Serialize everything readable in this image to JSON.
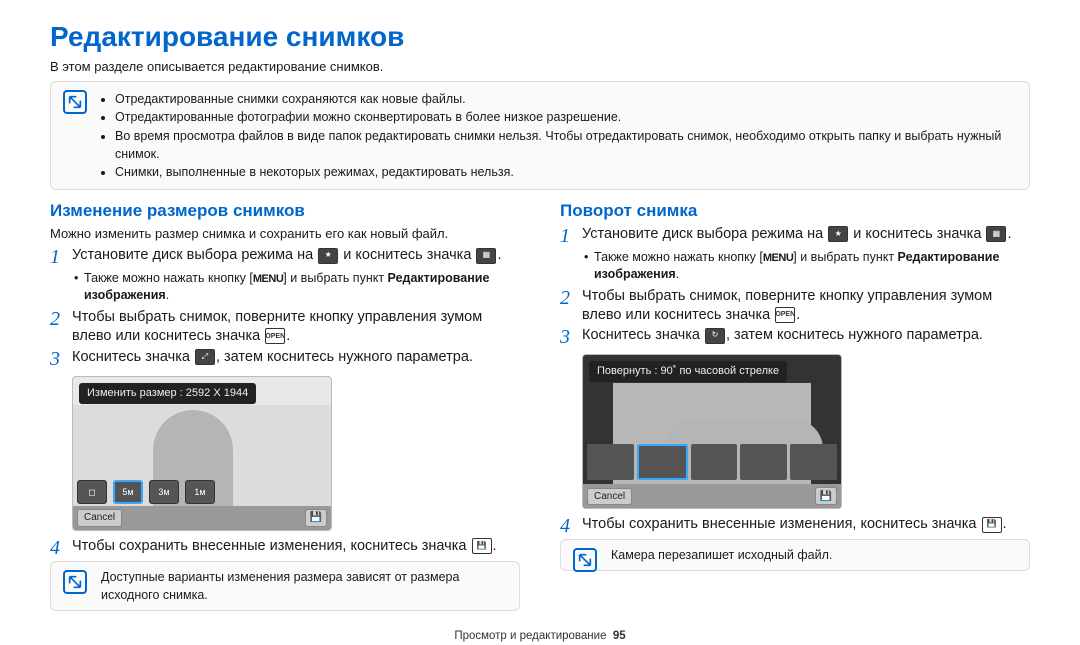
{
  "title": "Редактирование снимков",
  "intro": "В этом разделе описывается редактирование снимков.",
  "top_note": {
    "items": [
      "Отредактированные снимки сохраняются как новые файлы.",
      "Отредактированные фотографии можно сконвертировать в более низкое разрешение.",
      "Во время просмотра файлов в виде папок редактировать снимки нельзя. Чтобы отредактировать снимок, необходимо открыть папку и выбрать нужный снимок.",
      "Снимки, выполненные в некоторых режимах, редактировать нельзя."
    ]
  },
  "left": {
    "heading": "Изменение размеров снимков",
    "sub": "Можно изменить размер снимка и сохранить его как новый файл.",
    "step1a": "Установите диск выбора режима на ",
    "step1b": " и коснитесь значка ",
    "step1c": ".",
    "bullet1a": "Также можно нажать кнопку [",
    "bullet1_menu": "MENU",
    "bullet1b": "] и выбрать пункт ",
    "bullet1_bold": "Редактирование изображения",
    "bullet1c": ".",
    "step2": "Чтобы выбрать снимок, поверните кнопку управления зумом влево или коснитесь значка ",
    "open_label": "OPEN",
    "step2end": ".",
    "step3": "Коснитесь значка ",
    "step3b": ", затем коснитесь нужного параметра.",
    "screenshot_header": "Изменить размер : 2592 X 1944",
    "cancel": "Cancel",
    "sizes": [
      "",
      "5м",
      "3м",
      "1м"
    ],
    "step4": "Чтобы сохранить внесенные изменения, коснитесь значка ",
    "step4end": ".",
    "bottom_note": "Доступные варианты изменения размера зависят от размера исходного снимка."
  },
  "right": {
    "heading": "Поворот снимка",
    "step1a": "Установите диск выбора режима на ",
    "step1b": " и коснитесь значка ",
    "step1c": ".",
    "bullet1a": "Также можно нажать кнопку [",
    "bullet1_menu": "MENU",
    "bullet1b": "] и выбрать пункт ",
    "bullet1_bold": "Редактирование изображения",
    "bullet1c": ".",
    "step2": "Чтобы выбрать снимок, поверните кнопку управления зумом влево или коснитесь значка ",
    "open_label": "OPEN",
    "step2end": ".",
    "step3": "Коснитесь значка ",
    "step3b": ", затем коснитесь нужного параметра.",
    "screenshot_header": "Повернуть : 90˚ по часовой стрелке",
    "cancel": "Cancel",
    "step4": "Чтобы сохранить внесенные изменения, коснитесь значка ",
    "step4end": ".",
    "bottom_note": "Камера перезапишет исходный файл."
  },
  "footer": {
    "text": "Просмотр и редактирование",
    "page": "95"
  }
}
